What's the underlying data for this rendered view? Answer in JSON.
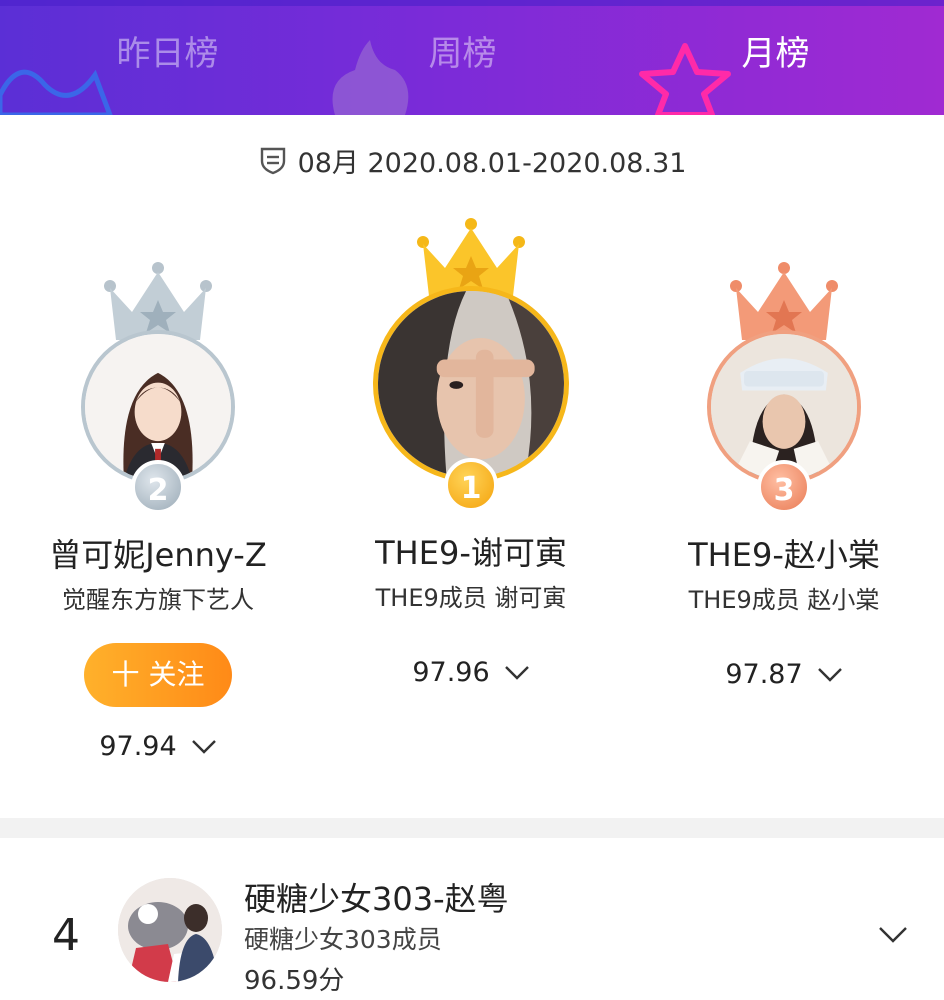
{
  "tabs": {
    "yesterday": "昨日榜",
    "week": "周榜",
    "month": "月榜"
  },
  "period": {
    "text": "08月 2020.08.01-2020.08.31"
  },
  "podium": {
    "second": {
      "rank": "2",
      "name": "曾可妮Jenny-Z",
      "subtitle": "觉醒东方旗下艺人",
      "follow_label": "十 关注",
      "score": "97.94"
    },
    "first": {
      "rank": "1",
      "name": "THE9-谢可寅",
      "subtitle": "THE9成员 谢可寅",
      "score": "97.96"
    },
    "third": {
      "rank": "3",
      "name": "THE9-赵小棠",
      "subtitle": "THE9成员 赵小棠",
      "score": "97.87"
    }
  },
  "list": [
    {
      "rank": "4",
      "name": "硬糖少女303-赵粤",
      "subtitle": "硬糖少女303成员",
      "score": "96.59分"
    }
  ],
  "colors": {
    "header_start": "#5b2fd6",
    "header_end": "#a02ad2",
    "gold": "#f6b71a",
    "silver": "#b9c6cf",
    "bronze": "#f0a080",
    "follow_button": "#ff9a1f"
  }
}
